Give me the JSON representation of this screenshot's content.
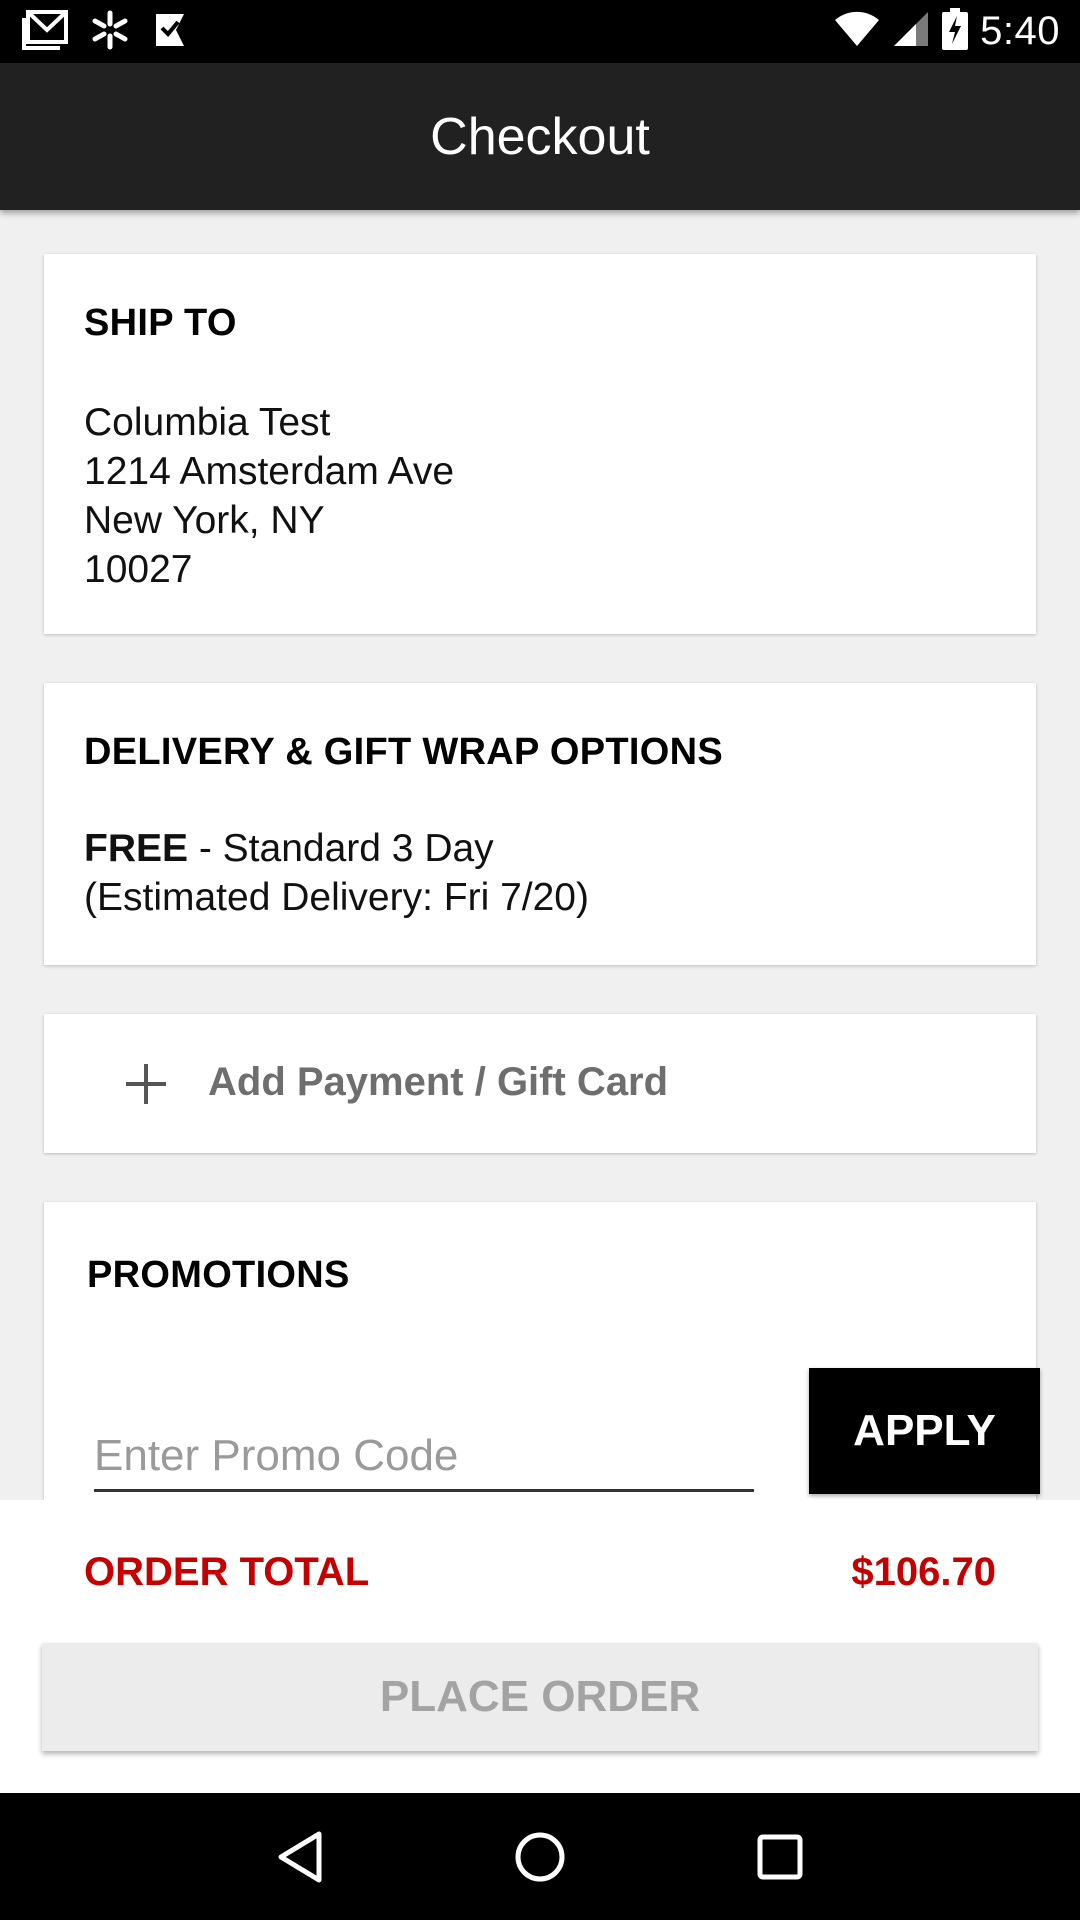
{
  "status_bar": {
    "time": "5:40",
    "icons": [
      "gmail-icon",
      "walmart-spark-icon",
      "checkbox-flag-icon",
      "wifi-icon",
      "cell-signal-icon",
      "battery-charging-icon"
    ]
  },
  "app_bar": {
    "title": "Checkout"
  },
  "ship_to": {
    "heading": "SHIP TO",
    "name": "Columbia Test",
    "street": "1214 Amsterdam Ave",
    "city_state": "New York, NY",
    "zip": "10027"
  },
  "delivery": {
    "heading": "DELIVERY & GIFT WRAP OPTIONS",
    "price": "FREE",
    "method": " - Standard 3 Day",
    "estimate": "(Estimated Delivery: Fri 7/20)"
  },
  "payment": {
    "label": "Add Payment / Gift Card",
    "icon": "plus-icon"
  },
  "promotions": {
    "heading": "PROMOTIONS",
    "placeholder": "Enter Promo Code",
    "apply_label": "APPLY"
  },
  "order": {
    "total_label": "ORDER TOTAL",
    "total_value": "$106.70",
    "place_order_label": "PLACE ORDER",
    "accent_color": "#c50000"
  },
  "nav_bar": {
    "icons": [
      "back-icon",
      "home-icon",
      "recents-icon"
    ]
  }
}
